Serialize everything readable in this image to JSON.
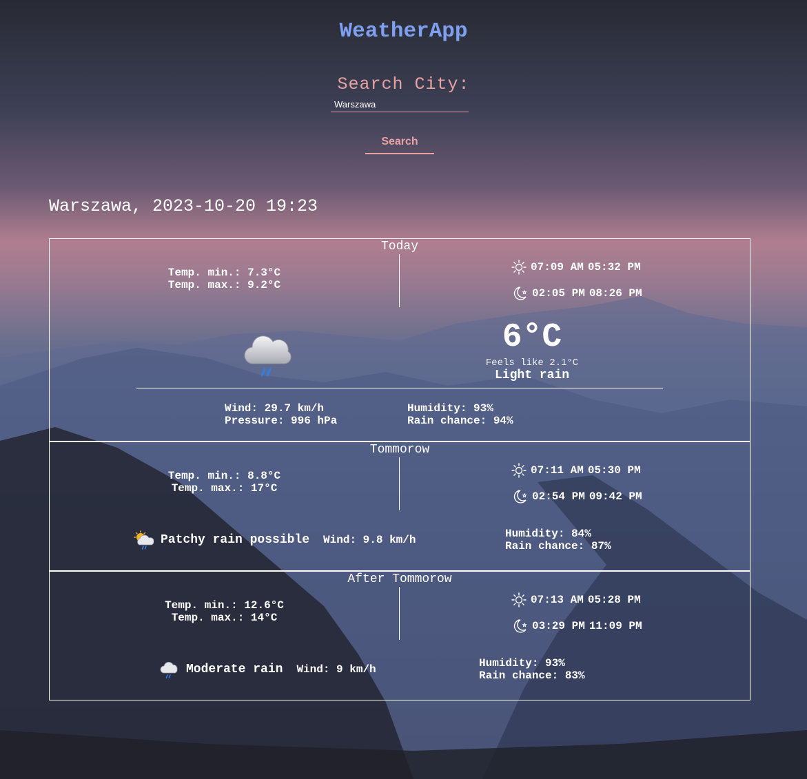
{
  "app": {
    "title": "WeatherApp"
  },
  "search": {
    "label": "Search City:",
    "value": "Warszawa",
    "button_label": "Search"
  },
  "location": {
    "heading": "Warszawa, 2023-10-20 19:23"
  },
  "colors": {
    "title": "#7fa0f0",
    "accent": "#e8a2a2",
    "text": "#ffffff"
  },
  "today": {
    "title": "Today",
    "temp_min": "Temp. min.: 7.3°C",
    "temp_max": "Temp. max.: 9.2°C",
    "sunrise": "07:09 AM",
    "sunset": "05:32 PM",
    "moonrise": "02:05 PM",
    "moonset": "08:26 PM",
    "temp": "6°C",
    "feels_like": "Feels like 2.1°C",
    "condition": "Light rain",
    "condition_icon": "cloud-rain-icon",
    "wind": "Wind: 29.7 km/h",
    "pressure": "Pressure: 996 hPa",
    "humidity": "Humidity: 93%",
    "rain_chance": "Rain chance: 94%"
  },
  "tomorrow": {
    "title": "Tommorow",
    "temp_min": "Temp. min.: 8.8°C",
    "temp_max": "Temp. max.: 17°C",
    "sunrise": "07:11 AM",
    "sunset": "05:30 PM",
    "moonrise": "02:54 PM",
    "moonset": "09:42 PM",
    "condition": "Patchy rain possible",
    "condition_icon": "sun-cloud-rain-icon",
    "wind": "Wind: 9.8 km/h",
    "humidity": "Humidity: 84%",
    "rain_chance": "Rain chance: 87%"
  },
  "after_tomorrow": {
    "title": "After Tommorow",
    "temp_min": "Temp. min.: 12.6°C",
    "temp_max": "Temp. max.: 14°C",
    "sunrise": "07:13 AM",
    "sunset": "05:28 PM",
    "moonrise": "03:29 PM",
    "moonset": "11:09 PM",
    "condition": "Moderate rain",
    "condition_icon": "cloud-rain-icon",
    "wind": "Wind: 9 km/h",
    "humidity": "Humidity: 93%",
    "rain_chance": "Rain chance: 83%"
  }
}
